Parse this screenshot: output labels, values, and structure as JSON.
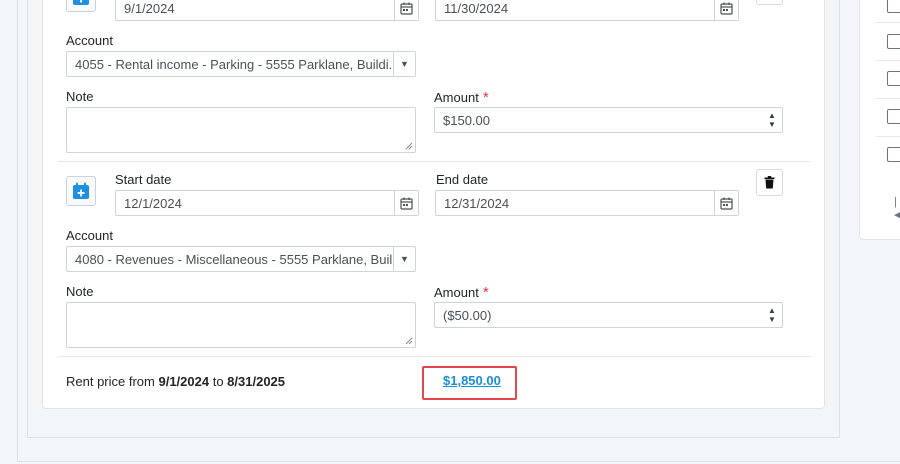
{
  "rows": [
    {
      "start_date": "9/1/2024",
      "end_date": "11/30/2024",
      "account_label": "Account",
      "account_value": "4055 - Rental income - Parking - 5555 Parklane, Buildi...",
      "note_label": "Note",
      "amount_label": "Amount",
      "amount_value": "$150.00"
    },
    {
      "start_label": "Start date",
      "end_label": "End date",
      "start_date": "12/1/2024",
      "end_date": "12/31/2024",
      "account_label": "Account",
      "account_value": "4080 - Revenues - Miscellaneous - 5555 Parklane, Buil...",
      "note_label": "Note",
      "amount_label": "Amount",
      "amount_value": "($50.00)"
    }
  ],
  "required_mark": "*",
  "summary": {
    "prefix": "Rent price from ",
    "from_date": "9/1/2024",
    "middle": " to ",
    "to_date": "8/31/2025",
    "total": "$1,850.00"
  },
  "colors": {
    "accent": "#1a8fd6",
    "required": "#dc3545",
    "highlight_box": "#e34848"
  },
  "icons": {
    "calendar_add": "calendar-plus-icon",
    "calendar": "calendar-icon",
    "trash": "trash-icon",
    "caret": "caret-down-icon"
  }
}
